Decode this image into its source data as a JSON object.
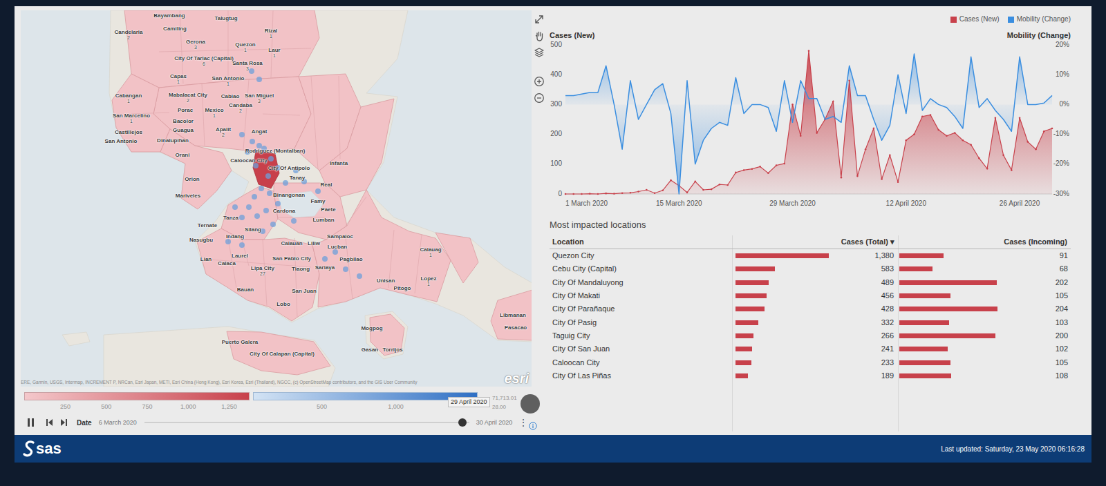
{
  "map": {
    "places": [
      {
        "name": "Bayambang"
      },
      {
        "name": "Talugtug"
      },
      {
        "name": "Candelaria",
        "count": "2"
      },
      {
        "name": "Camiling"
      },
      {
        "name": "Rizal",
        "count": "1"
      },
      {
        "name": "Gerona",
        "count": "3"
      },
      {
        "name": "Quezon",
        "count": "1"
      },
      {
        "name": "Laur",
        "count": "1"
      },
      {
        "name": "City Of Tarlac (Capital)",
        "count": "6"
      },
      {
        "name": "Santa Rosa",
        "count": "3"
      },
      {
        "name": "Capas",
        "count": "1"
      },
      {
        "name": "San Antonio",
        "count": "1"
      },
      {
        "name": "Mabalacat City",
        "count": "2"
      },
      {
        "name": "Cabiao"
      },
      {
        "name": "Cabangan",
        "count": "1"
      },
      {
        "name": "San Miguel",
        "count": "3"
      },
      {
        "name": "Candaba",
        "count": "2"
      },
      {
        "name": "San Marcelino",
        "count": "1"
      },
      {
        "name": "Porac"
      },
      {
        "name": "Mexico",
        "count": "1"
      },
      {
        "name": "Bacolor"
      },
      {
        "name": "Guagua"
      },
      {
        "name": "Apalit",
        "count": "2"
      },
      {
        "name": "Angat"
      },
      {
        "name": "Castillejos"
      },
      {
        "name": "San Antonio"
      },
      {
        "name": "Dinalupihan"
      },
      {
        "name": "Orani"
      },
      {
        "name": "Rodriguez (Montalban)"
      },
      {
        "name": "Caloocan City"
      },
      {
        "name": "City Of Antipolo"
      },
      {
        "name": "Infanta"
      },
      {
        "name": "Orion"
      },
      {
        "name": "Tanay"
      },
      {
        "name": "Real"
      },
      {
        "name": "Mariveles"
      },
      {
        "name": "Binangonan"
      },
      {
        "name": "Famy"
      },
      {
        "name": "Cardona"
      },
      {
        "name": "Paete"
      },
      {
        "name": "Tanza"
      },
      {
        "name": "Ternate"
      },
      {
        "name": "Lumban"
      },
      {
        "name": "Silang"
      },
      {
        "name": "Indang"
      },
      {
        "name": "Nasugbu"
      },
      {
        "name": "Sampaloc"
      },
      {
        "name": "Calauan"
      },
      {
        "name": "Liliw"
      },
      {
        "name": "Lucban"
      },
      {
        "name": "Lian"
      },
      {
        "name": "Laurel"
      },
      {
        "name": "Calaca"
      },
      {
        "name": "San Pablo City"
      },
      {
        "name": "Pagbilao"
      },
      {
        "name": "Lipa City",
        "count": "27"
      },
      {
        "name": "Tiaong"
      },
      {
        "name": "Sariaya"
      },
      {
        "name": "Calauag",
        "count": "1"
      },
      {
        "name": "Unisan"
      },
      {
        "name": "Pitogo"
      },
      {
        "name": "Lopez",
        "count": "1"
      },
      {
        "name": "Bauan"
      },
      {
        "name": "San Juan"
      },
      {
        "name": "Lobo"
      },
      {
        "name": "Libmanan"
      },
      {
        "name": "Pasacao"
      },
      {
        "name": "Mogpog"
      },
      {
        "name": "Gasan"
      },
      {
        "name": "Torrijos"
      },
      {
        "name": "Puerto Galera"
      },
      {
        "name": "City Of Calapan (Capital)"
      }
    ],
    "attribution": "ERE, Garmin, USGS, Intermap, INCREMENT P, NRCan, Esri Japan, METI, Esri China (Hong Kong), Esri Korea, Esri (Thailand), NGCC, (c) OpenStreetMap contributors, and the GIS User Community",
    "logo": "esri",
    "legend": {
      "cases_labels": [
        "250",
        "500",
        "750",
        "1,000",
        "1,250"
      ],
      "mobility_labels": [
        "500",
        "1,000"
      ],
      "values": [
        "71,713.01",
        "28.00"
      ],
      "tooltip": "29 April 2020"
    },
    "timeline": {
      "playing": true,
      "label": "Date",
      "start": "6 March 2020",
      "end": "30 April 2020",
      "level": 0.98,
      "more": "⋮"
    }
  },
  "chart": {
    "legend": [
      {
        "label": "Cases (New)",
        "color": "#c8414b"
      },
      {
        "label": "Mobility (Change)",
        "color": "#3a8ee0"
      }
    ],
    "left_axis": {
      "title": "Cases (New)",
      "ticks": [
        "500",
        "400",
        "300",
        "200",
        "100",
        "0"
      ]
    },
    "right_axis": {
      "title": "Mobility (Change)",
      "ticks": [
        "20%",
        "10%",
        "0%",
        "-10%",
        "-20%",
        "-30%"
      ]
    },
    "x_labels": [
      "1 March 2020",
      "15 March 2020",
      "29 March 2020",
      "12 April 2020",
      "26 April 2020"
    ],
    "series": {
      "cases_new": [
        0,
        0,
        0,
        1,
        0,
        2,
        1,
        3,
        4,
        8,
        14,
        3,
        12,
        46,
        28,
        5,
        42,
        14,
        16,
        32,
        30,
        72,
        80,
        84,
        92,
        70,
        96,
        102,
        300,
        195,
        480,
        205,
        250,
        310,
        55,
        380,
        60,
        150,
        220,
        50,
        130,
        40,
        180,
        200,
        260,
        265,
        215,
        195,
        205,
        180,
        165,
        120,
        85,
        255,
        130,
        80,
        255,
        175,
        150,
        210,
        220
      ],
      "mobility_change": [
        3,
        3,
        3.5,
        4,
        4,
        13,
        0,
        -15,
        8,
        -5,
        0,
        5,
        7,
        -3,
        -30,
        8,
        -20,
        -12,
        -8,
        -6,
        -7,
        9,
        -3,
        0,
        0,
        -1,
        -9,
        8,
        -6,
        8,
        2,
        2,
        -5,
        -4,
        -6,
        13,
        3,
        3,
        -5,
        -12,
        -7,
        10,
        -3,
        17,
        -2,
        2,
        0,
        -1,
        -4,
        -8,
        16,
        -1,
        2,
        -2,
        -5,
        -9,
        16,
        0,
        0,
        0.5,
        3
      ]
    }
  },
  "table": {
    "title": "Most impacted locations",
    "columns": [
      {
        "label": "Location"
      },
      {
        "label": "Cases (Total) ▾"
      },
      {
        "label": "Cases (Incoming)"
      }
    ],
    "rows": [
      {
        "location": "Quezon City",
        "total": "1,380",
        "total_level": 0.9,
        "incoming": "91",
        "incoming_level": 0.4
      },
      {
        "location": "Cebu City (Capital)",
        "total": "583",
        "total_level": 0.38,
        "incoming": "68",
        "incoming_level": 0.3
      },
      {
        "location": "City Of Mandaluyong",
        "total": "489",
        "total_level": 0.32,
        "incoming": "202",
        "incoming_level": 0.88
      },
      {
        "location": "City Of Makati",
        "total": "456",
        "total_level": 0.3,
        "incoming": "105",
        "incoming_level": 0.46
      },
      {
        "location": "City Of Parañaque",
        "total": "428",
        "total_level": 0.28,
        "incoming": "204",
        "incoming_level": 0.89
      },
      {
        "location": "City Of Pasig",
        "total": "332",
        "total_level": 0.22,
        "incoming": "103",
        "incoming_level": 0.45
      },
      {
        "location": "Taguig City",
        "total": "266",
        "total_level": 0.17,
        "incoming": "200",
        "incoming_level": 0.87
      },
      {
        "location": "City Of San Juan",
        "total": "241",
        "total_level": 0.16,
        "incoming": "102",
        "incoming_level": 0.44
      },
      {
        "location": "Caloocan City",
        "total": "233",
        "total_level": 0.15,
        "incoming": "105",
        "incoming_level": 0.46
      },
      {
        "location": "City Of Las Piñas",
        "total": "189",
        "total_level": 0.12,
        "incoming": "108",
        "incoming_level": 0.47
      }
    ]
  },
  "footer": {
    "logo": "sas",
    "last_updated": "Last updated: Saturday, 23 May 2020 06:16:28"
  }
}
